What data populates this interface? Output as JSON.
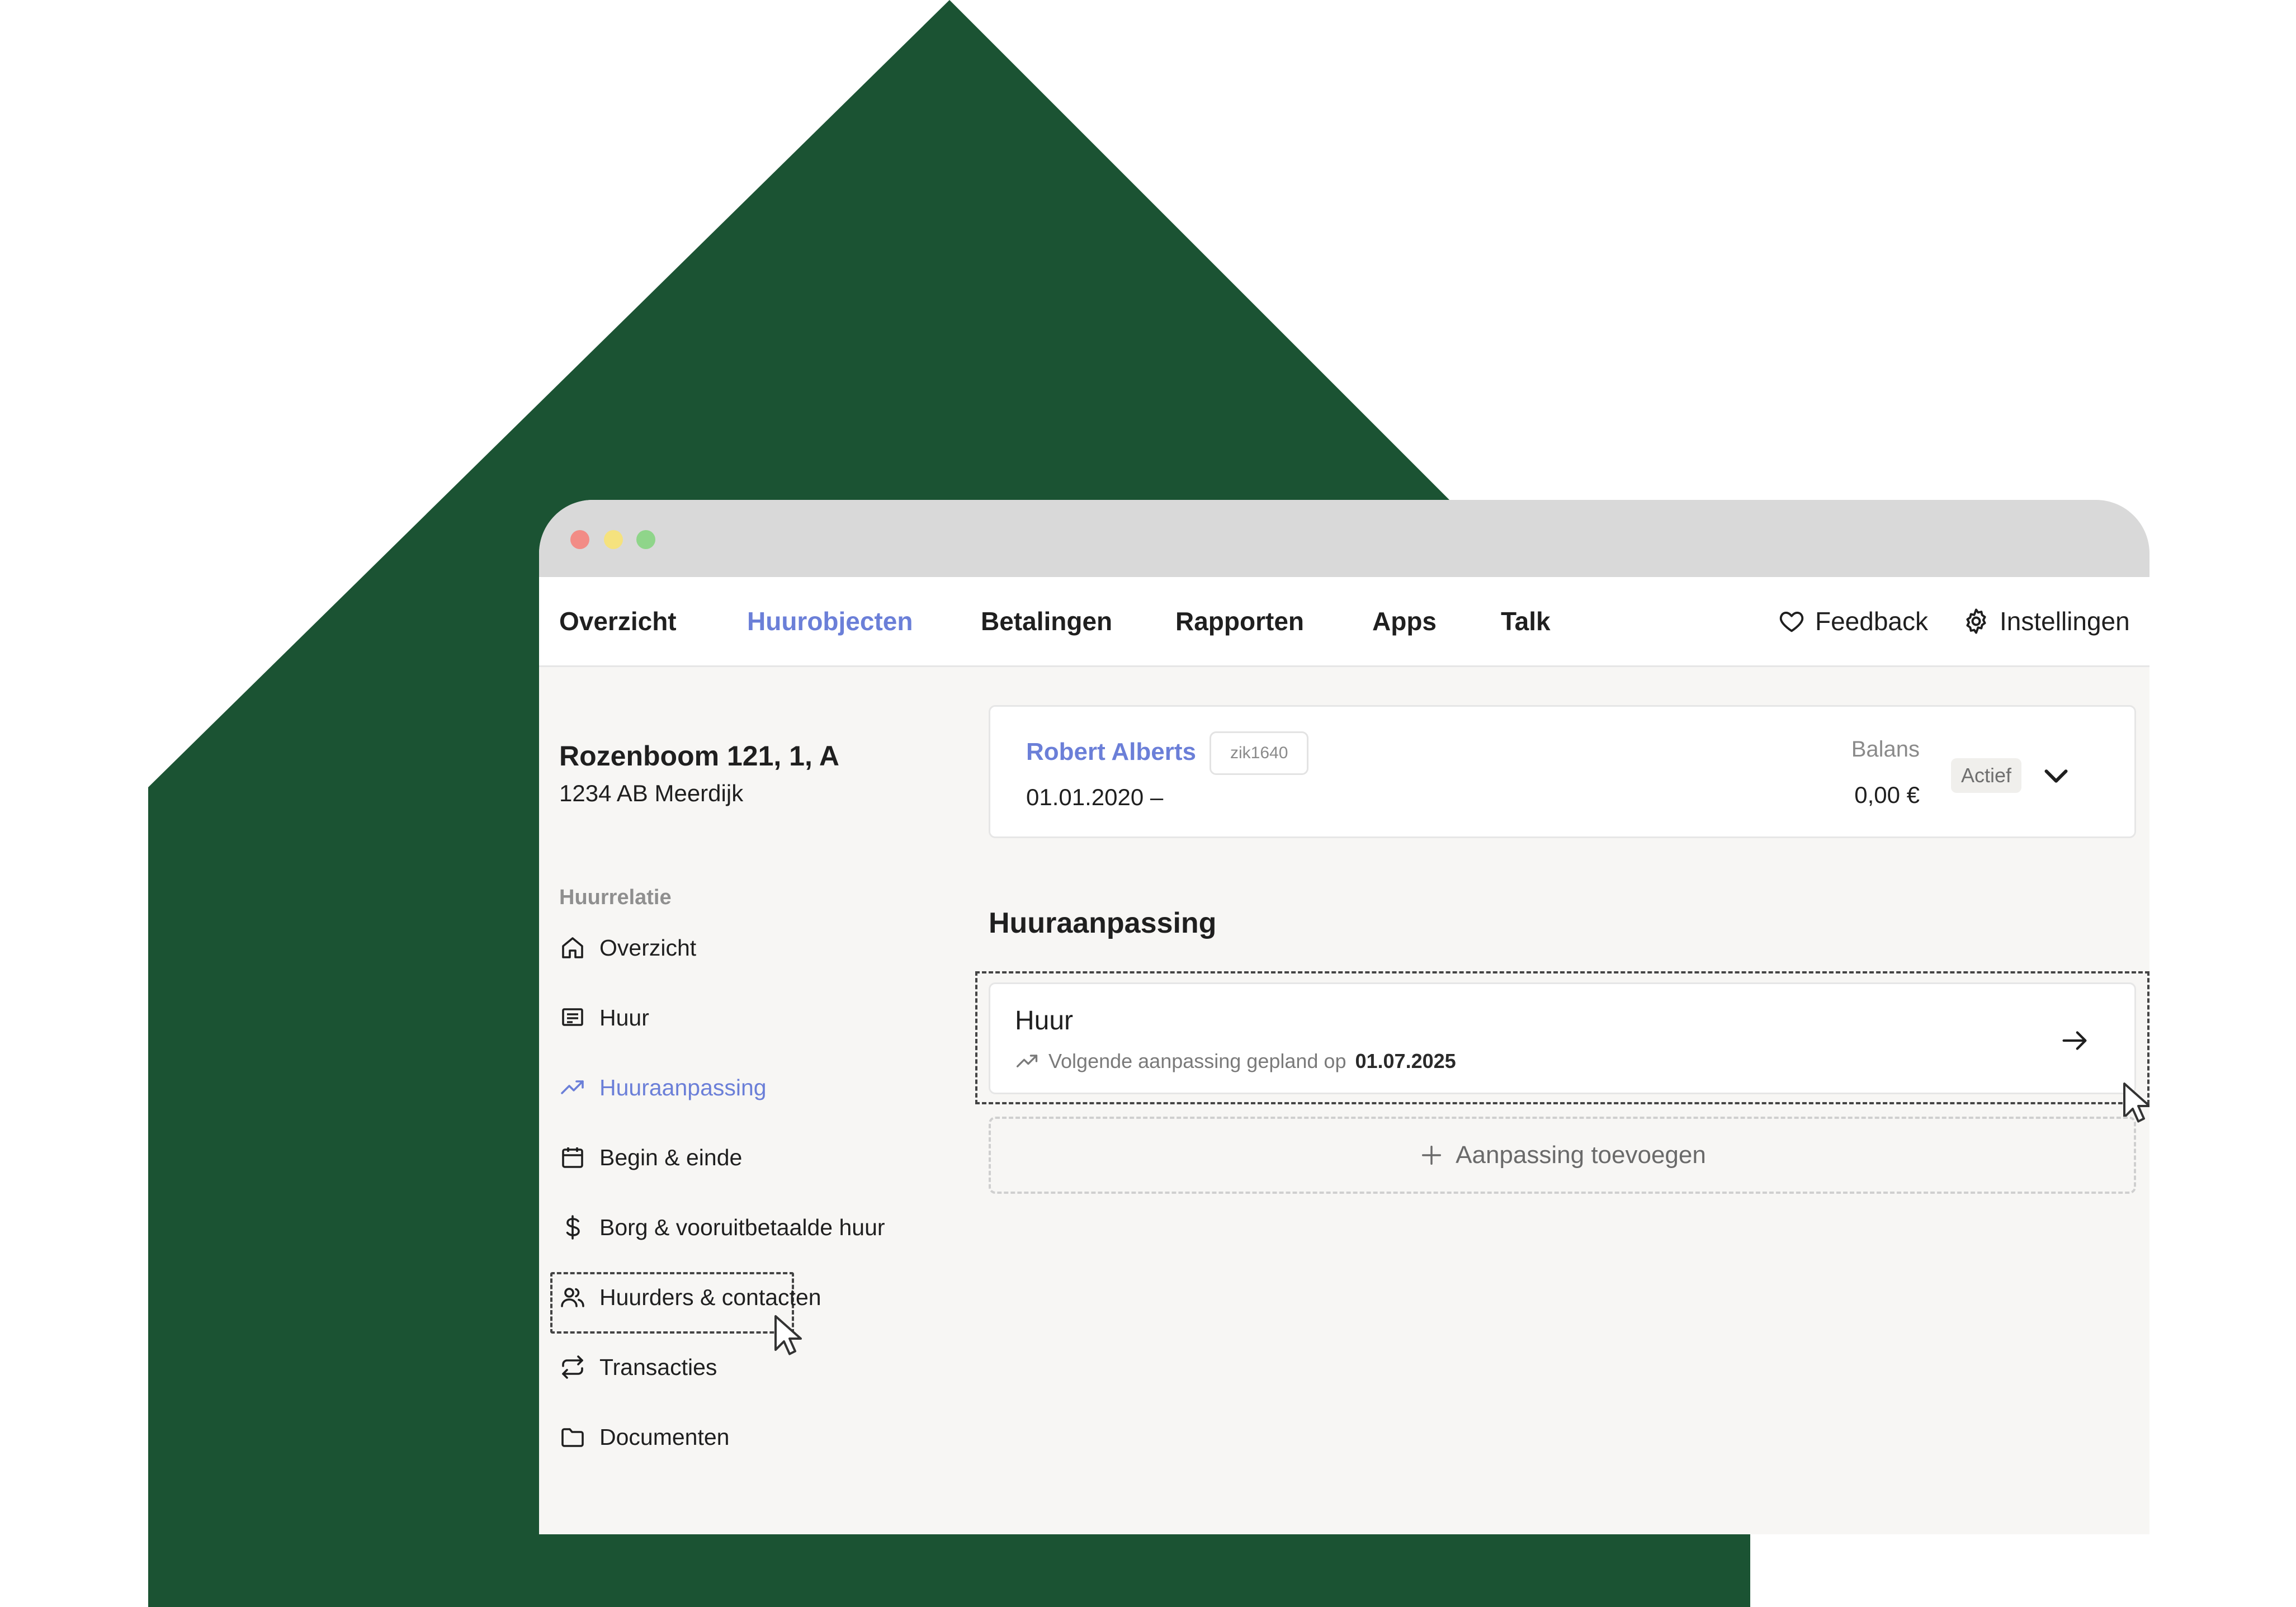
{
  "colors": {
    "house": "#1b5333",
    "accent": "#6b7fd8",
    "window_bar": "#d9d9d9"
  },
  "window": {
    "controls": [
      "close",
      "minimize",
      "maximize"
    ]
  },
  "topnav": {
    "items": [
      "Overzicht",
      "Huurobjecten",
      "Betalingen",
      "Rapporten",
      "Apps",
      "Talk"
    ],
    "active": "Huurobjecten",
    "feedback": {
      "label": "Feedback",
      "icon": "heart-icon"
    },
    "settings": {
      "label": "Instellingen",
      "icon": "gear-icon"
    }
  },
  "property": {
    "title": "Rozenboom 121, 1, A",
    "subtitle": "1234 AB Meerdijk"
  },
  "sidebar": {
    "heading": "Huurrelatie",
    "items": [
      {
        "label": "Overzicht",
        "icon": "home-icon"
      },
      {
        "label": "Huur",
        "icon": "receipt-icon"
      },
      {
        "label": "Huuraanpassing",
        "icon": "trend-up-icon",
        "active": true
      },
      {
        "label": "Begin & einde",
        "icon": "calendar-icon"
      },
      {
        "label": "Borg & vooruitbetaalde huur",
        "icon": "dollar-icon"
      },
      {
        "label": "Huurders & contacten",
        "icon": "users-icon"
      },
      {
        "label": "Transacties",
        "icon": "repeat-icon"
      },
      {
        "label": "Documenten",
        "icon": "folder-icon"
      }
    ]
  },
  "tenant": {
    "name": "Robert Alberts",
    "code": "zik1640",
    "date": "01.01.2020 –",
    "balance_label": "Balans",
    "balance_value": "0,00 €",
    "status": "Actief"
  },
  "section": {
    "title": "Huuraanpassing"
  },
  "rent_card": {
    "title": "Huur",
    "next_text": "Volgende aanpassing gepland op",
    "next_date": "01.07.2025"
  },
  "add_button": {
    "label": "Aanpassing toevoegen"
  }
}
